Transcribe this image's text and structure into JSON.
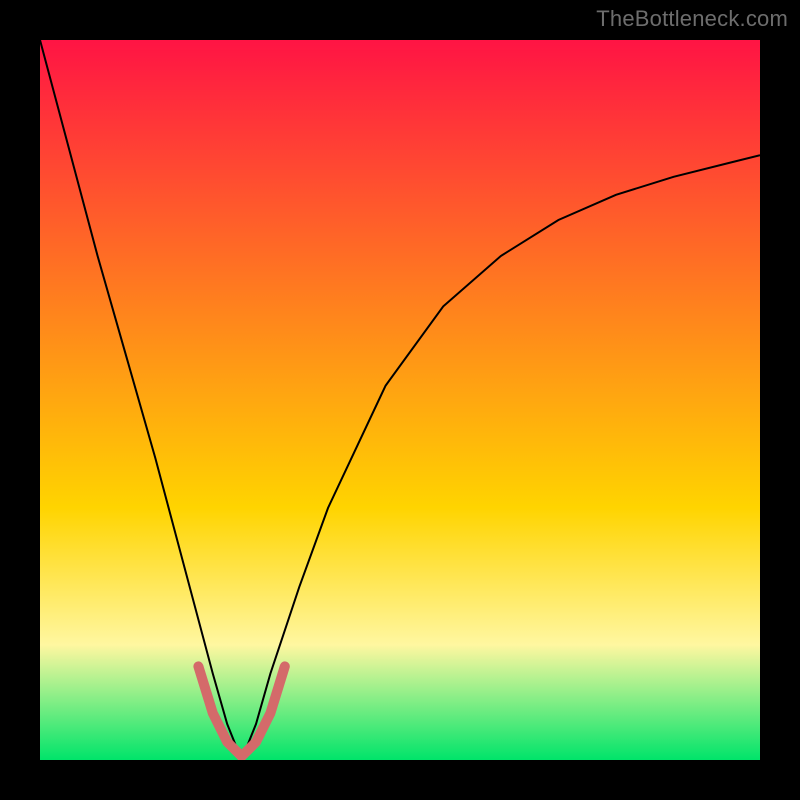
{
  "attribution": "TheBottleneck.com",
  "chart_data": {
    "type": "line",
    "title": "",
    "xlabel": "",
    "ylabel": "",
    "xlim": [
      0,
      100
    ],
    "ylim": [
      0,
      100
    ],
    "grid": false,
    "legend": false,
    "background_gradient": {
      "top_color": "#ff1444",
      "mid_color": "#ffd400",
      "mid_stop_pct": 65,
      "lower_color": "#fff7a0",
      "lower_stop_pct": 84,
      "bottom_color": "#00e46a"
    },
    "series": [
      {
        "name": "bottleneck-curve",
        "x_for_min_y": 28,
        "stroke": "#000000",
        "stroke_width": 2,
        "x": [
          0,
          4,
          8,
          12,
          16,
          20,
          24,
          26,
          28,
          30,
          32,
          36,
          40,
          48,
          56,
          64,
          72,
          80,
          88,
          96,
          100
        ],
        "y": [
          100,
          85,
          70,
          56,
          42,
          27,
          12,
          5,
          0,
          5,
          12,
          24,
          35,
          52,
          63,
          70,
          75,
          78.5,
          81,
          83,
          84
        ]
      },
      {
        "name": "valley-highlight",
        "stroke": "#d46a6a",
        "stroke_width": 10,
        "x": [
          22,
          24,
          26,
          28,
          30,
          32,
          34
        ],
        "y": [
          13,
          6.5,
          2.5,
          0.5,
          2.5,
          6.5,
          13
        ]
      }
    ],
    "annotations": []
  }
}
